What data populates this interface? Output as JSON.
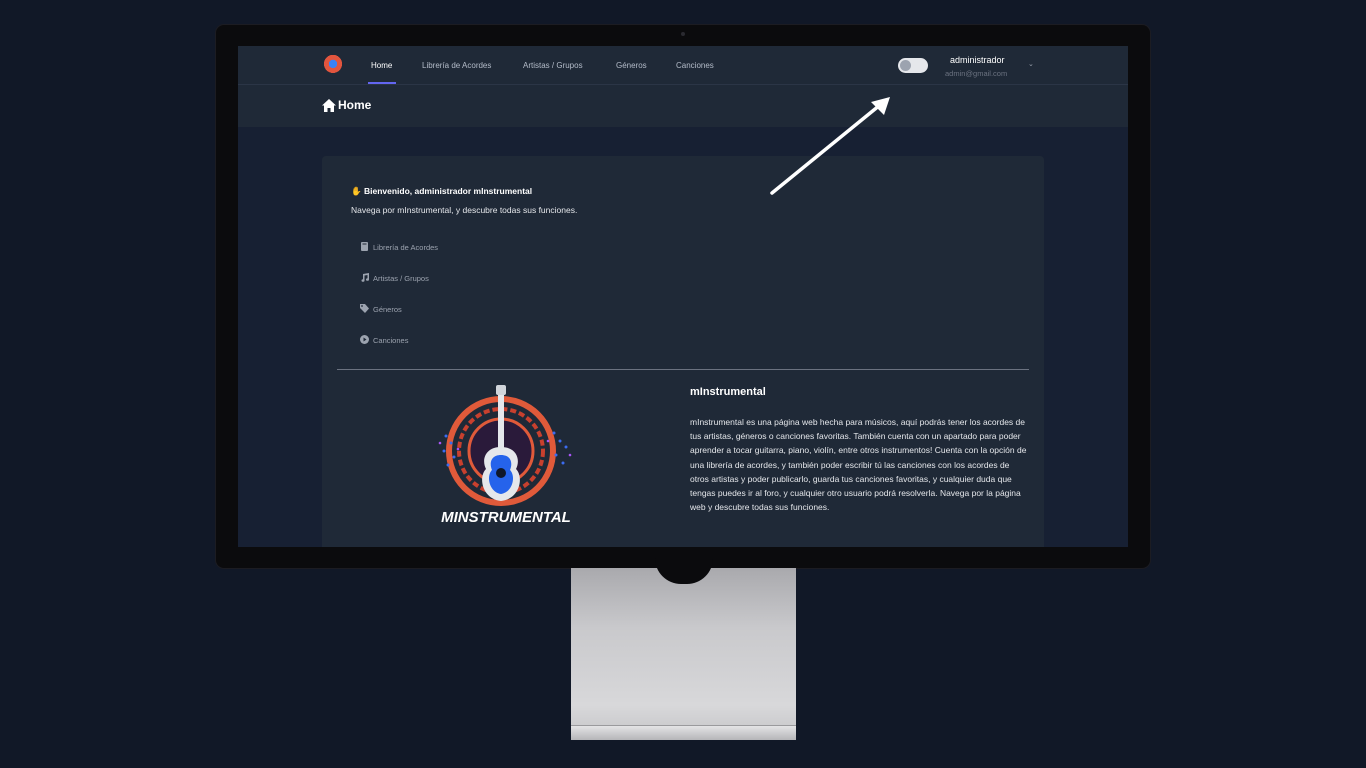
{
  "navbar": {
    "links": [
      {
        "label": "Home",
        "active": true
      },
      {
        "label": "Librería de Acordes",
        "active": false
      },
      {
        "label": "Artistas / Grupos",
        "active": false
      },
      {
        "label": "Géneros",
        "active": false
      },
      {
        "label": "Canciones",
        "active": false
      }
    ],
    "user": {
      "name": "administrador",
      "email": "admin@gmail.com"
    },
    "theme_toggle_on": false
  },
  "header": {
    "title": "Home",
    "icon": "home-icon"
  },
  "welcome": {
    "heading": "Bienvenido, administrador mInstrumental",
    "subtitle": "Navega por mInstrumental, y descubre todas sus funciones.",
    "features": [
      {
        "label": "Librería de Acordes",
        "icon": "book-icon"
      },
      {
        "label": "Artistas / Grupos",
        "icon": "music-note-icon"
      },
      {
        "label": "Géneros",
        "icon": "tag-icon"
      },
      {
        "label": "Canciones",
        "icon": "play-circle-icon"
      }
    ]
  },
  "about": {
    "logo_text": "MINSTRUMENTAL",
    "title": "mInstrumental",
    "body": "mInstrumental es una página web hecha para músicos, aquí podrás tener los acordes de tus artistas, géneros o canciones favoritas. También cuenta con un apartado para poder aprender a tocar guitarra, piano, violín, entre otros instrumentos! Cuenta con la opción de una librería de acordes, y también poder escribir tú las canciones con los acordes de otros artistas y poder publicarlo, guarda tus canciones favoritas, y cualquier duda que tengas puedes ir al foro, y cualquier otro usuario podrá resolverla. Navega por la página web y descubre todas sus funciones."
  },
  "colors": {
    "page_bg": "#111827",
    "screen_bg": "#172033",
    "panel_bg": "#1f2937",
    "accent": "#6366f1"
  }
}
